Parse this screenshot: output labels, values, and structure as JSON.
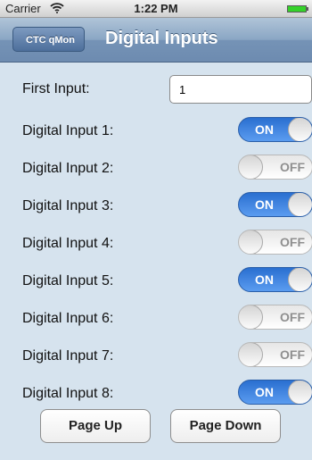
{
  "status_bar": {
    "carrier": "Carrier",
    "time": "1:22 PM",
    "wifi_icon": "wifi-icon",
    "battery_icon": "battery-icon",
    "battery_color": "#35d12a"
  },
  "nav": {
    "back_label": "CTC qMon",
    "title": "Digital Inputs"
  },
  "first_input": {
    "label": "First Input:",
    "value": "1"
  },
  "inputs": [
    {
      "label": "Digital Input 1:",
      "state": "ON"
    },
    {
      "label": "Digital Input 2:",
      "state": "OFF"
    },
    {
      "label": "Digital Input 3:",
      "state": "ON"
    },
    {
      "label": "Digital Input 4:",
      "state": "OFF"
    },
    {
      "label": "Digital Input 5:",
      "state": "ON"
    },
    {
      "label": "Digital Input 6:",
      "state": "OFF"
    },
    {
      "label": "Digital Input 7:",
      "state": "OFF"
    },
    {
      "label": "Digital Input 8:",
      "state": "ON"
    }
  ],
  "buttons": {
    "page_up": "Page Up",
    "page_down": "Page Down"
  },
  "colors": {
    "background": "#d6e3ee",
    "toggle_on": "#3a82e0",
    "nav_bar": "#7f9cc0"
  }
}
